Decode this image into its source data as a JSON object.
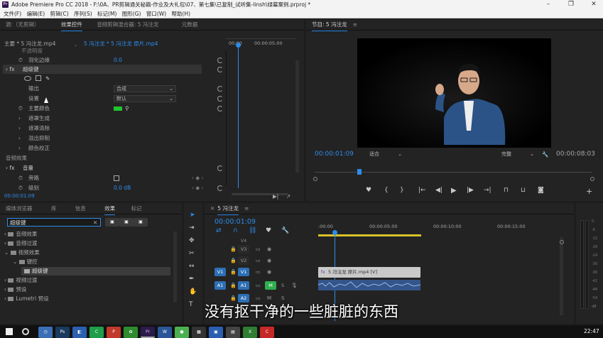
{
  "window": {
    "title": "Adobe Premiere Pro CC 2018 - F:\\0A、PR剪辑通关秘籍-作业及大礼包\\07、第七集\\已复制_试听集-linsh\\绿幕案例.prproj *"
  },
  "menu": [
    "文件(F)",
    "编辑(E)",
    "剪辑(C)",
    "序列(S)",
    "标记(M)",
    "图形(G)",
    "窗口(W)",
    "帮助(H)"
  ],
  "effects_panel": {
    "tabs": [
      "源:（无剪辑）",
      "效果控件",
      "音频剪辑混合器: 5 冯注龙",
      "元数据"
    ],
    "master": "主要 * 5 冯注龙.mp4",
    "clip": "5 冯注龙 * 5 冯注龙 原片.mp4",
    "ruler": [
      "00:00",
      "00:00:05:00"
    ],
    "rows": {
      "opacity_partial": "不透明度",
      "feather": "羽化边缘",
      "feather_value": "0.0",
      "ultra_key": "超级键",
      "output": "输出",
      "output_value": "合成",
      "setting": "设置",
      "setting_value": "默认",
      "key_color": "主要颜色",
      "matte_gen": "遮罩生成",
      "matte_clean": "遮罩清除",
      "spill": "溢出抑制",
      "color_correct": "颜色校正",
      "audio_effects": "音频效果",
      "volume": "音量",
      "bypass": "旁路",
      "level": "级别",
      "level_value": "0.0 dB"
    },
    "timecode": "00:00:01:09"
  },
  "program": {
    "title": "节目: 5 冯注龙",
    "timecode": "00:00:01:09",
    "fit": "适合",
    "quality": "完整",
    "duration": "00:00:08:03"
  },
  "project": {
    "tabs": [
      "媒体浏览器",
      "库",
      "信息",
      "效果",
      "标记"
    ],
    "search": "超级键",
    "tree": [
      "音频效果",
      "音频过渡",
      "视频效果",
      "键控",
      "超级键",
      "视频过渡",
      "预设",
      "Lumetri 预设"
    ]
  },
  "timeline": {
    "title": "5 冯注龙",
    "timecode": "00:00:01:09",
    "ruler": [
      ":00:00",
      "00:00:05:00",
      "00:00:10:00",
      "00:00:15:00"
    ],
    "tracks": [
      "V3",
      "V2",
      "V1",
      "A1",
      "A2"
    ],
    "v4": "V4",
    "src_v": "V1",
    "src_a": "A1",
    "m": "M",
    "s": "S",
    "clip_v": "5 冯注龙 原片.mp4 [V]",
    "vu_ticks": [
      "0",
      "-6",
      "-12",
      "-18",
      "-24",
      "-30",
      "-36",
      "-42",
      "-48",
      "-54",
      "dB"
    ]
  },
  "subtitle": "没有抠干净的一些脏脏的东西",
  "taskbar": {
    "time": "22:47"
  }
}
